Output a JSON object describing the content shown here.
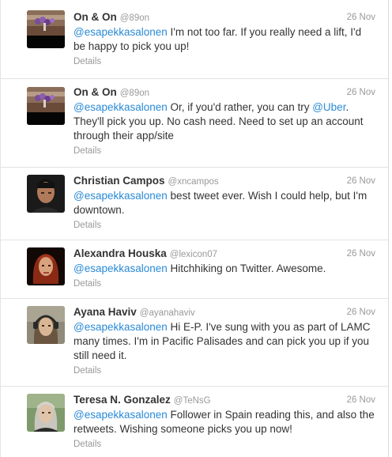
{
  "tweets": [
    {
      "fullname": "On & On",
      "username": "@89on",
      "time": "26 Nov",
      "text_parts": [
        {
          "t": "@esapekkasalonen",
          "link": true
        },
        {
          "t": " I'm not too far. If you really need a lift, I'd be happy to pick you up!",
          "link": false
        }
      ],
      "details": "Details",
      "avatar": "purple-flowers-table-photo"
    },
    {
      "fullname": "On & On",
      "username": "@89on",
      "time": "26 Nov",
      "text_parts": [
        {
          "t": "@esapekkasalonen",
          "link": true
        },
        {
          "t": " Or, if you'd rather, you can try ",
          "link": false
        },
        {
          "t": "@Uber",
          "link": true
        },
        {
          "t": ". They'll pick you up. No cash need. Need to set up an account through their app/site",
          "link": false
        }
      ],
      "details": "Details",
      "avatar": "purple-flowers-table-photo"
    },
    {
      "fullname": "Christian Campos",
      "username": "@xncampos",
      "time": "26 Nov",
      "text_parts": [
        {
          "t": "@esapekkasalonen",
          "link": true
        },
        {
          "t": " best tweet ever. Wish I could help, but I'm downtown.",
          "link": false
        }
      ],
      "details": "Details",
      "avatar": "man-portrait-photo"
    },
    {
      "fullname": "Alexandra Houska",
      "username": "@lexicon07",
      "time": "26 Nov",
      "text_parts": [
        {
          "t": "@esapekkasalonen",
          "link": true
        },
        {
          "t": " Hitchhiking on Twitter. Awesome.",
          "link": false
        }
      ],
      "details": "Details",
      "avatar": "woman-red-hair-photo"
    },
    {
      "fullname": "Ayana Haviv",
      "username": "@ayanahaviv",
      "time": "26 Nov",
      "text_parts": [
        {
          "t": "@esapekkasalonen",
          "link": true
        },
        {
          "t": " Hi E-P. I've sung with you as part of LAMC many times. I'm in Pacific Palisades and can pick you up if you still need it.",
          "link": false
        }
      ],
      "details": "Details",
      "avatar": "woman-headphones-photo"
    },
    {
      "fullname": "Teresa N. Gonzalez",
      "username": "@TeNsG",
      "time": "26 Nov",
      "text_parts": [
        {
          "t": "@esapekkasalonen",
          "link": true
        },
        {
          "t": " Follower in Spain reading this, and also the retweets. Wishing someone picks you up now!",
          "link": false
        }
      ],
      "details": "Details",
      "avatar": "woman-gray-hair-photo"
    }
  ],
  "colors": {
    "link": "#2a8ad6",
    "meta": "#999999",
    "name": "#333333",
    "divider": "#e3e3e3"
  }
}
